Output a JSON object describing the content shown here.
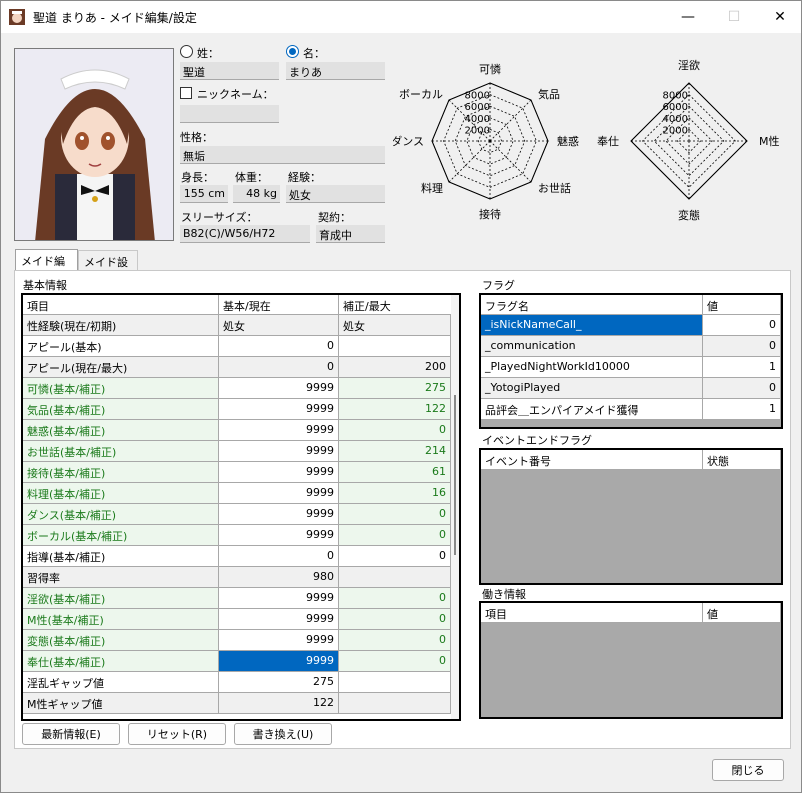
{
  "window": {
    "title": "聖道 まりあ - メイド編集/設定",
    "minimize": "—",
    "maximize": "☐",
    "close": "✕"
  },
  "profile": {
    "surname_label": "姓：",
    "surname": "聖道",
    "name_label": "名：",
    "name": "まりあ",
    "nickname_label": "ニックネーム：",
    "nickname": "",
    "personality_label": "性格：",
    "personality": "無垢",
    "height_label": "身長：",
    "height": "155 cm",
    "weight_label": "体重：",
    "weight": "48 kg",
    "experience_label": "経験：",
    "experience": "処女",
    "three_sizes_label": "スリーサイズ：",
    "three_sizes": "B82(C)/W56/H72",
    "contract_label": "契約：",
    "contract": "育成中"
  },
  "radar_left": {
    "axes": [
      "可憐",
      "気品",
      "魅惑",
      "お世話",
      "接待",
      "料理",
      "ダンス",
      "ボーカル"
    ],
    "ticks": [
      "2000",
      "4000",
      "6000",
      "8000"
    ],
    "values": [
      9999,
      9999,
      9999,
      9999,
      9999,
      9999,
      9999,
      9999
    ]
  },
  "radar_right": {
    "axes": [
      "淫欲",
      "M性",
      "変態",
      "奉仕"
    ],
    "ticks": [
      "2000",
      "4000",
      "6000",
      "8000"
    ],
    "values": [
      9999,
      9999,
      9999,
      9999
    ]
  },
  "tabs": [
    "メイド編集",
    "メイド設定"
  ],
  "basic": {
    "group_label": "基本情報",
    "headers": [
      "項目",
      "基本/現在",
      "補正/最大"
    ],
    "rows": [
      {
        "item": "性経験(現在/初期)",
        "base": "処女",
        "mod": "処女",
        "style": "grey"
      },
      {
        "item": "アピール(基本)",
        "base": "0",
        "mod": "",
        "style": "white"
      },
      {
        "item": "アピール(現在/最大)",
        "base": "0",
        "mod": "200",
        "style": "grey"
      },
      {
        "item": "可憐(基本/補正)",
        "base": "9999",
        "mod": "275",
        "style": "green"
      },
      {
        "item": "気品(基本/補正)",
        "base": "9999",
        "mod": "122",
        "style": "green"
      },
      {
        "item": "魅惑(基本/補正)",
        "base": "9999",
        "mod": "0",
        "style": "green"
      },
      {
        "item": "お世話(基本/補正)",
        "base": "9999",
        "mod": "214",
        "style": "green"
      },
      {
        "item": "接待(基本/補正)",
        "base": "9999",
        "mod": "61",
        "style": "green"
      },
      {
        "item": "料理(基本/補正)",
        "base": "9999",
        "mod": "16",
        "style": "green"
      },
      {
        "item": "ダンス(基本/補正)",
        "base": "9999",
        "mod": "0",
        "style": "green"
      },
      {
        "item": "ボーカル(基本/補正)",
        "base": "9999",
        "mod": "0",
        "style": "green"
      },
      {
        "item": "指導(基本/補正)",
        "base": "0",
        "mod": "0",
        "style": "white"
      },
      {
        "item": "習得率",
        "base": "980",
        "mod": "",
        "style": "grey"
      },
      {
        "item": "淫欲(基本/補正)",
        "base": "9999",
        "mod": "0",
        "style": "green"
      },
      {
        "item": "M性(基本/補正)",
        "base": "9999",
        "mod": "0",
        "style": "green"
      },
      {
        "item": "変態(基本/補正)",
        "base": "9999",
        "mod": "0",
        "style": "green"
      },
      {
        "item": "奉仕(基本/補正)",
        "base": "9999",
        "mod": "0",
        "style": "green-sel"
      },
      {
        "item": "淫乱ギャップ値",
        "base": "275",
        "mod": "",
        "style": "white"
      },
      {
        "item": "M性ギャップ値",
        "base": "122",
        "mod": "",
        "style": "grey"
      }
    ]
  },
  "flags": {
    "group_label": "フラグ",
    "headers": [
      "フラグ名",
      "値"
    ],
    "rows": [
      {
        "name": "_isNickNameCall_",
        "value": "0",
        "selected": true
      },
      {
        "name": "_communication",
        "value": "0",
        "selected": false
      },
      {
        "name": "_PlayedNightWorkId10000",
        "value": "1",
        "selected": false
      },
      {
        "name": "_YotogiPlayed",
        "value": "0",
        "selected": false
      },
      {
        "name": "品評会＿エンパイアメイド獲得",
        "value": "1",
        "selected": false
      }
    ]
  },
  "event_flags": {
    "group_label": "イベントエンドフラグ",
    "headers": [
      "イベント番号",
      "状態"
    ]
  },
  "work_info": {
    "group_label": "働き情報",
    "headers": [
      "項目",
      "値"
    ]
  },
  "buttons": {
    "refresh": "最新情報(E)",
    "reset": "リセット(R)",
    "rewrite": "書き換え(U)",
    "close": "閉じる"
  },
  "colors": {
    "selection": "#0067c0",
    "green_text": "#1a7a1a",
    "green_row": "#edf7ed"
  }
}
